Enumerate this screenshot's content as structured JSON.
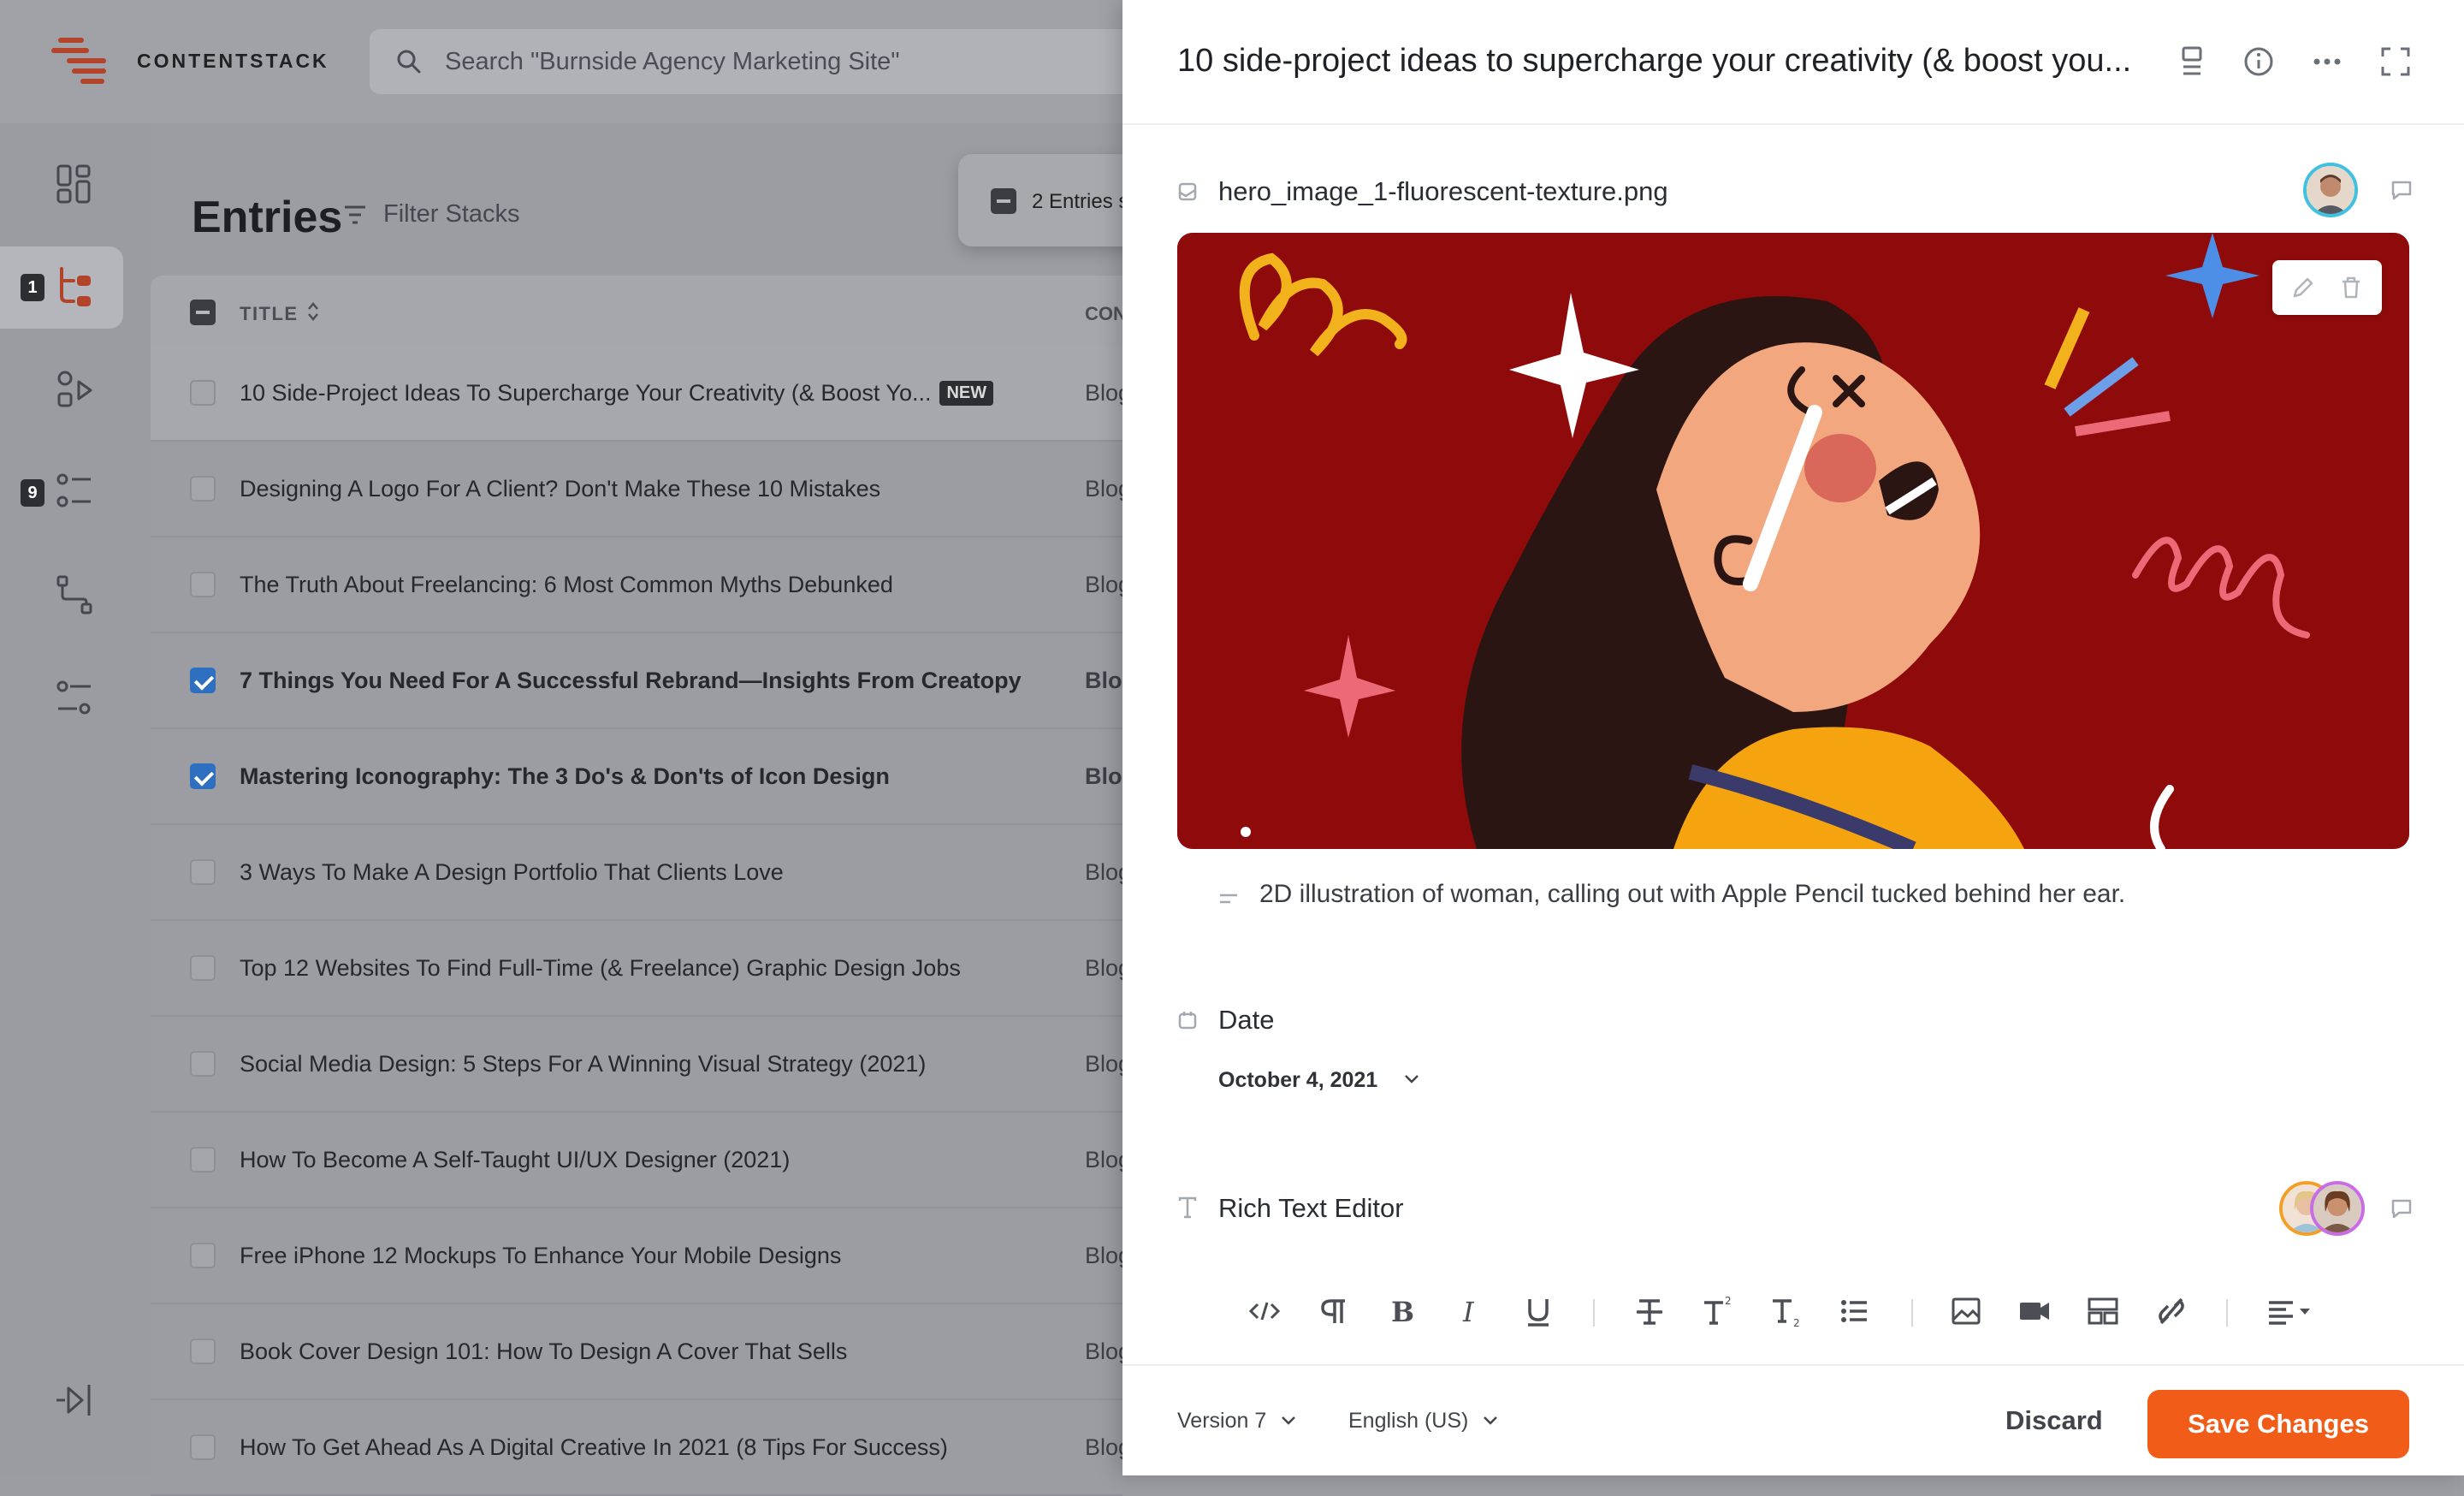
{
  "app": {
    "brand": "CONTENTSTACK"
  },
  "search": {
    "placeholder": "Search \"Burnside Agency Marketing Site\""
  },
  "nav": {
    "badges": [
      "1",
      "9"
    ]
  },
  "entries": {
    "heading": "Entries",
    "filter_label": "Filter Stacks",
    "selection_label": "2 Entries s",
    "columns": {
      "title": "TITLE",
      "content_type": "CON"
    },
    "new_badge": "NEW",
    "rows": [
      {
        "title": "10 Side-Project Ideas To Supercharge Your Creativity (& Boost Yo...",
        "type": "Blog",
        "checked": false,
        "isNew": true
      },
      {
        "title": "Designing A Logo For A Client? Don't Make These 10 Mistakes",
        "type": "Blog",
        "checked": false
      },
      {
        "title": "The Truth About Freelancing: 6 Most Common Myths Debunked",
        "type": "Blog",
        "checked": false
      },
      {
        "title": "7 Things You Need For A Successful Rebrand—Insights From Creatopy",
        "type": "Blog",
        "checked": true
      },
      {
        "title": "Mastering Iconography: The 3 Do's & Don'ts of Icon Design",
        "type": "Blog",
        "checked": true
      },
      {
        "title": "3 Ways To Make A Design Portfolio That Clients Love",
        "type": "Blog",
        "checked": false
      },
      {
        "title": "Top 12 Websites To Find Full-Time (& Freelance) Graphic Design Jobs",
        "type": "Blog",
        "checked": false
      },
      {
        "title": "Social Media Design: 5 Steps For A Winning Visual Strategy (2021)",
        "type": "Blog",
        "checked": false
      },
      {
        "title": "How To Become A Self-Taught UI/UX Designer (2021)",
        "type": "Blog",
        "checked": false
      },
      {
        "title": "Free iPhone 12 Mockups To Enhance Your Mobile Designs",
        "type": "Blog",
        "checked": false
      },
      {
        "title": "Book Cover Design 101: How To Design A Cover That Sells",
        "type": "Blog",
        "checked": false
      },
      {
        "title": "How To Get Ahead As A Digital Creative In 2021 (8 Tips For Success)",
        "type": "Blog",
        "checked": false
      }
    ]
  },
  "panel": {
    "title": "10 side-project ideas to supercharge your creativity (& boost you...",
    "image_field": {
      "filename": "hero_image_1-fluorescent-texture.png",
      "caption": "2D illustration of woman, calling out with Apple Pencil tucked behind her ear."
    },
    "date_field": {
      "label": "Date",
      "value": "October 4, 2021"
    },
    "rte_field": {
      "label": "Rich Text Editor"
    },
    "footer": {
      "version": "Version 7",
      "language": "English (US)",
      "discard": "Discard",
      "save": "Save Changes"
    }
  },
  "colors": {
    "accent": "#f25c19",
    "checkbox": "#2e6fbf",
    "illustration_bg": "#8f0b0b",
    "brand": "#b1442a"
  }
}
